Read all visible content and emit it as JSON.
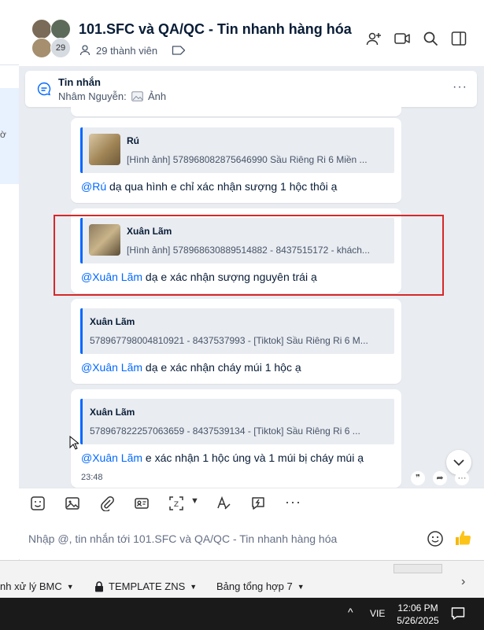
{
  "header": {
    "title": "101.SFC và QA/QC - Tin nhanh hàng hóa",
    "member_count": "29 thành viên",
    "avatar_badge": "29"
  },
  "left_fragment": {
    "text": "ờ"
  },
  "pinned": {
    "label": "Tin nhắn",
    "sender": "Nhâm Nguyễn:",
    "content": "Ảnh"
  },
  "messages": [
    {
      "quote_name": "Rú",
      "quote_text": "[Hình ảnh] 578968082875646990 Sầu Riêng Ri 6 Miền ...",
      "mention": "@Rú",
      "text": " dạ qua hình e chỉ xác nhận sượng 1 hộc thôi ạ"
    },
    {
      "quote_name": "Xuân Lãm",
      "quote_text": "[Hình ảnh] 578968630889514882 - 8437515172 - khách...",
      "mention": "@Xuân Lãm",
      "text": " dạ e xác nhận sượng nguyên trái ạ"
    },
    {
      "quote_name": "Xuân Lãm",
      "quote_text": "578967798004810921 - 8437537993 - [Tiktok] Sầu Riêng Ri 6 M...",
      "mention": "@Xuân Lãm",
      "text": " dạ e xác nhận cháy múi 1 hộc ạ"
    },
    {
      "quote_name": "Xuân Lãm",
      "quote_text": "578967822257063659 - 8437539134 - [Tiktok] Sầu Riêng Ri 6 ...",
      "mention": "@Xuân Lãm",
      "text": " e xác nhận 1 hộc úng và 1 múi bị cháy múi ạ",
      "time": "23:48"
    }
  ],
  "composer": {
    "placeholder": "Nhập @, tin nhắn tới 101.SFC và QA/QC - Tin nhanh hàng hóa"
  },
  "sheet_tabs": [
    {
      "label": "nh xử lý BMC"
    },
    {
      "label": "TEMPLATE ZNS"
    },
    {
      "label": "Bảng tổng hợp 7"
    }
  ],
  "taskbar": {
    "language": "VIE",
    "time": "12:06 PM",
    "date": "5/26/2025"
  },
  "colors": {
    "accent": "#0068ff",
    "highlight_box": "#d62828",
    "chat_bg": "#e9ecf1"
  }
}
